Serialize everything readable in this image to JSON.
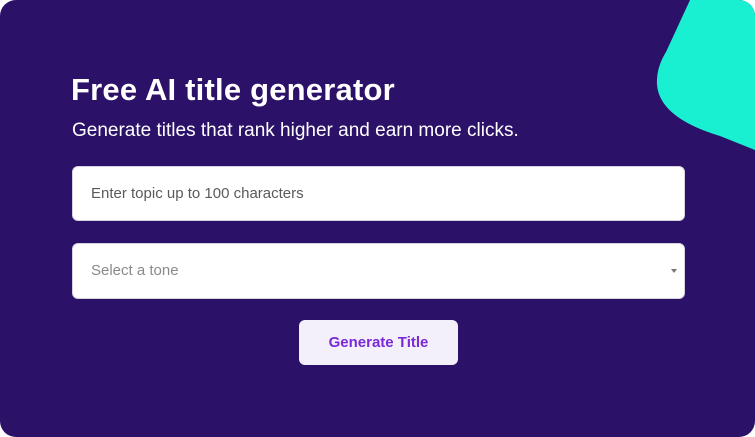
{
  "hero": {
    "title": "Free AI title generator",
    "subtitle": "Generate titles that rank higher and earn more clicks."
  },
  "form": {
    "topic_placeholder": "Enter topic up to 100 characters",
    "tone_placeholder": "Select a tone",
    "generate_label": "Generate Title"
  },
  "colors": {
    "background": "#2c1169",
    "accent_shape": "#19f0d2",
    "button_text": "#7a28d8",
    "button_background": "#f3f0fb"
  },
  "icons": {
    "tone_dropdown": "chevron-down-icon",
    "decoration": "teal-blob-shape"
  }
}
